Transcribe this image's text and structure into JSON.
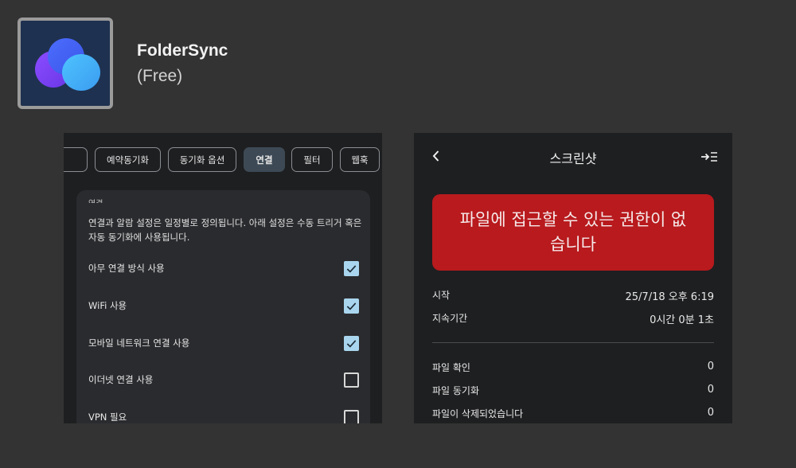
{
  "app": {
    "name": "FolderSync",
    "price": "(Free)"
  },
  "left_screen": {
    "tabs": [
      {
        "label": ""
      },
      {
        "label": "예약동기화"
      },
      {
        "label": "동기화 옵션"
      },
      {
        "label": "연결",
        "active": true
      },
      {
        "label": "필터"
      },
      {
        "label": "웹훅"
      }
    ],
    "section": {
      "heading": "연결",
      "description": "연결과 알람 설정은 일정별로 정의됩니다. 아래 설정은 수동 트리거 혹은 자동 동기화에 사용됩니다.",
      "options": [
        {
          "label": "아무 연결 방식 사용",
          "checked": true
        },
        {
          "label": "WiFi 사용",
          "checked": true
        },
        {
          "label": "모바일 네트워크 연결 사용",
          "checked": true
        },
        {
          "label": "이더넷 연결 사용",
          "checked": false
        },
        {
          "label": "VPN 필요",
          "checked": false
        }
      ]
    }
  },
  "right_screen": {
    "title": "스크린샷",
    "error_message": "파일에 접근할 수 있는 권한이 없습니다",
    "details": [
      {
        "label": "시작",
        "value": "25/7/18 오후 6:19"
      },
      {
        "label": "지속기간",
        "value": "0시간 0분 1초"
      }
    ],
    "stats": [
      {
        "label": "파일 확인",
        "value": "0"
      },
      {
        "label": "파일 동기화",
        "value": "0"
      },
      {
        "label": "파일이 삭제되었습니다",
        "value": "0"
      }
    ]
  },
  "colors": {
    "background": "#333333",
    "panel": "#1e1f21",
    "card": "#2a2b2e",
    "error": "#b81a1d",
    "checkbox_on": "#a9d6ee",
    "active_tab": "#3d4a55"
  },
  "icons": [
    "app-logo-icon",
    "back-arrow-icon",
    "export-icon",
    "checkmark-icon"
  ]
}
